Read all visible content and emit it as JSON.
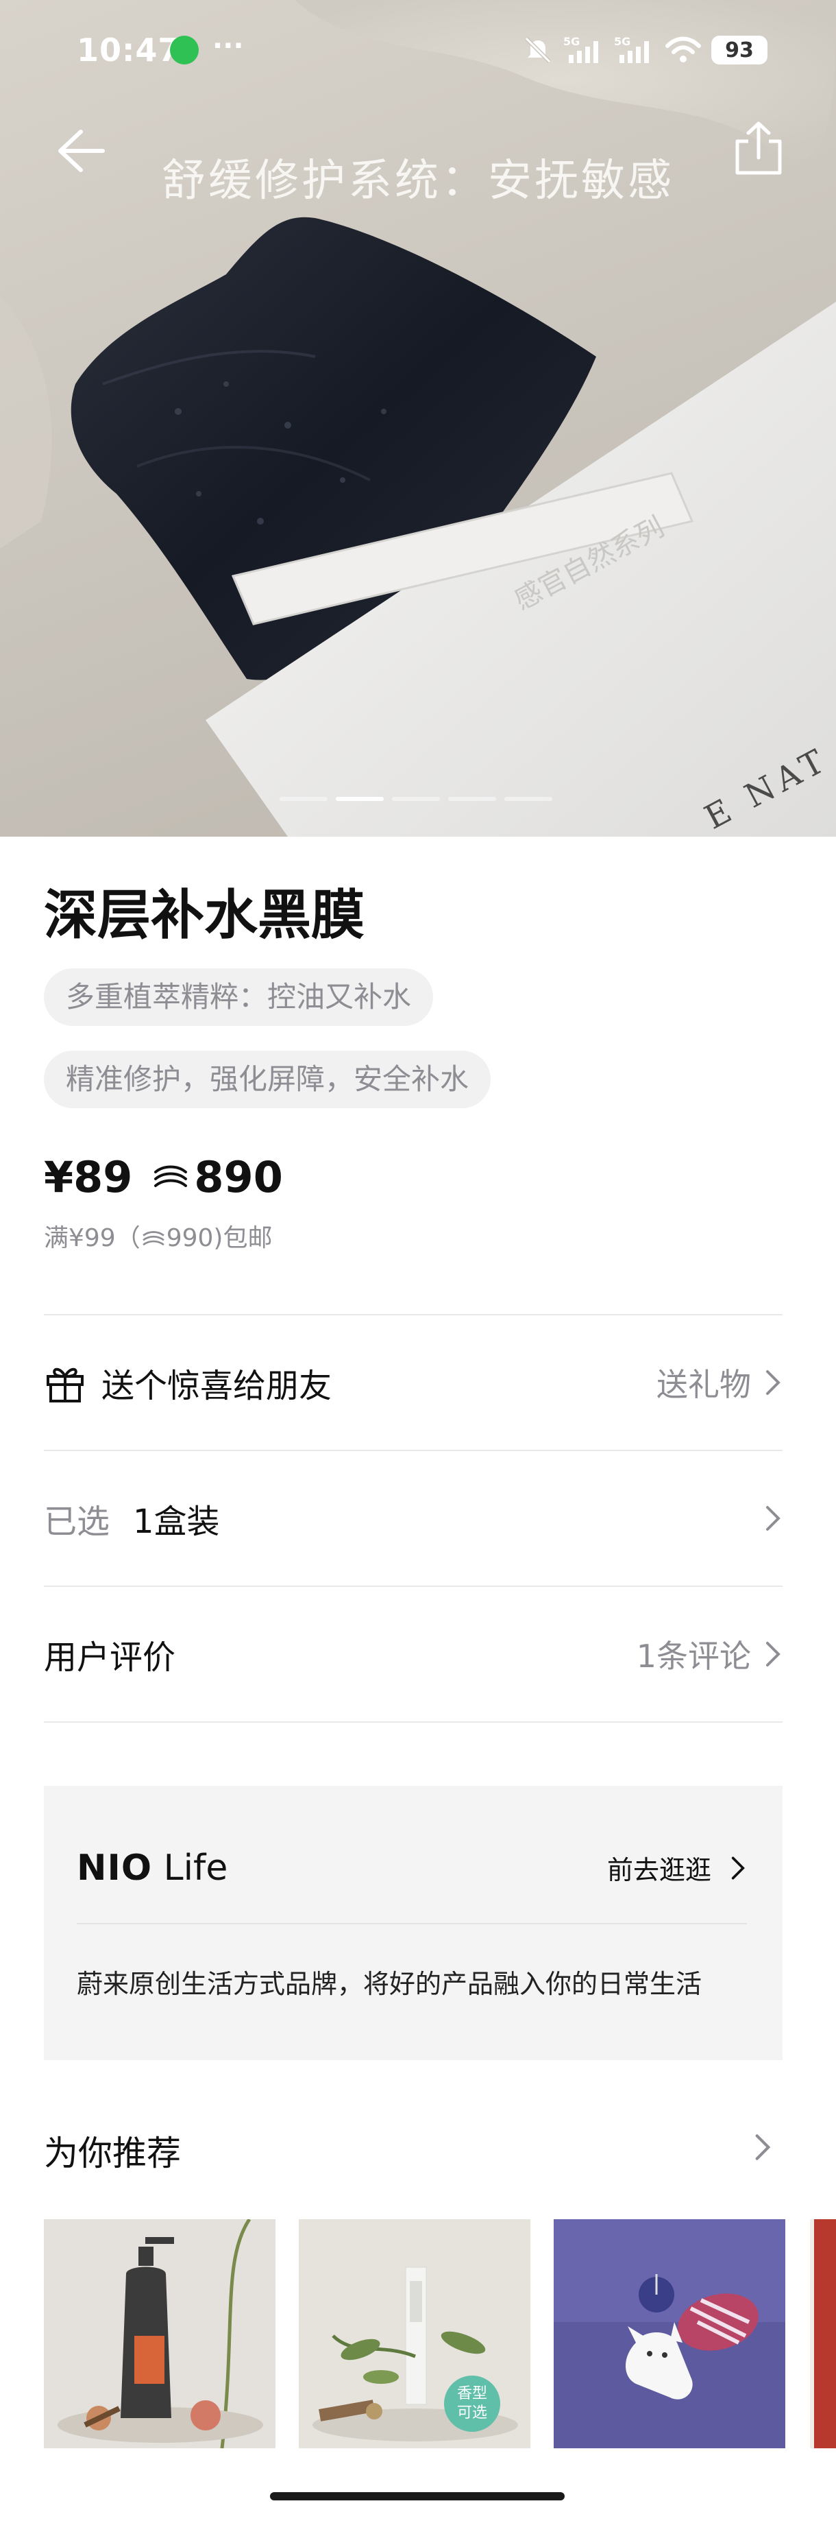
{
  "status_bar": {
    "time": "10:47",
    "more": "···",
    "net1": "5G",
    "net2": "5G",
    "battery": "93"
  },
  "hero": {
    "title": "舒缓修护系统：安抚敏感",
    "pack_print": "感官自然系列",
    "pack_brand": "E NAT",
    "slide_count": 5,
    "active_slide": 2
  },
  "product": {
    "name": "深层补水黑膜",
    "tags": [
      "多重植萃精粹：控油又补水",
      "精准修护，强化屏障，安全补水"
    ],
    "price": "¥89",
    "points_price": "890",
    "shipping": "满¥99（",
    "shipping_points": "990)包邮"
  },
  "rows": {
    "gift_label": "送个惊喜给朋友",
    "gift_action": "送礼物",
    "selected_label": "已选",
    "selected_value": "1盒装",
    "reviews_label": "用户评价",
    "reviews_count": "1条评论"
  },
  "brand": {
    "logo_main": "NIO",
    "logo_sub": "Life",
    "link": "前去逛逛",
    "description": "蔚来原创生活方式品牌，将好的产品融入你的日常生活"
  },
  "recommend": {
    "title": "为你推荐",
    "badge_line1": "香型",
    "badge_line2": "可选"
  },
  "colors": {
    "accent_badge": "#5fbfa8",
    "muted_text": "#8d8d93",
    "tag_bg": "#f1f1f2"
  }
}
